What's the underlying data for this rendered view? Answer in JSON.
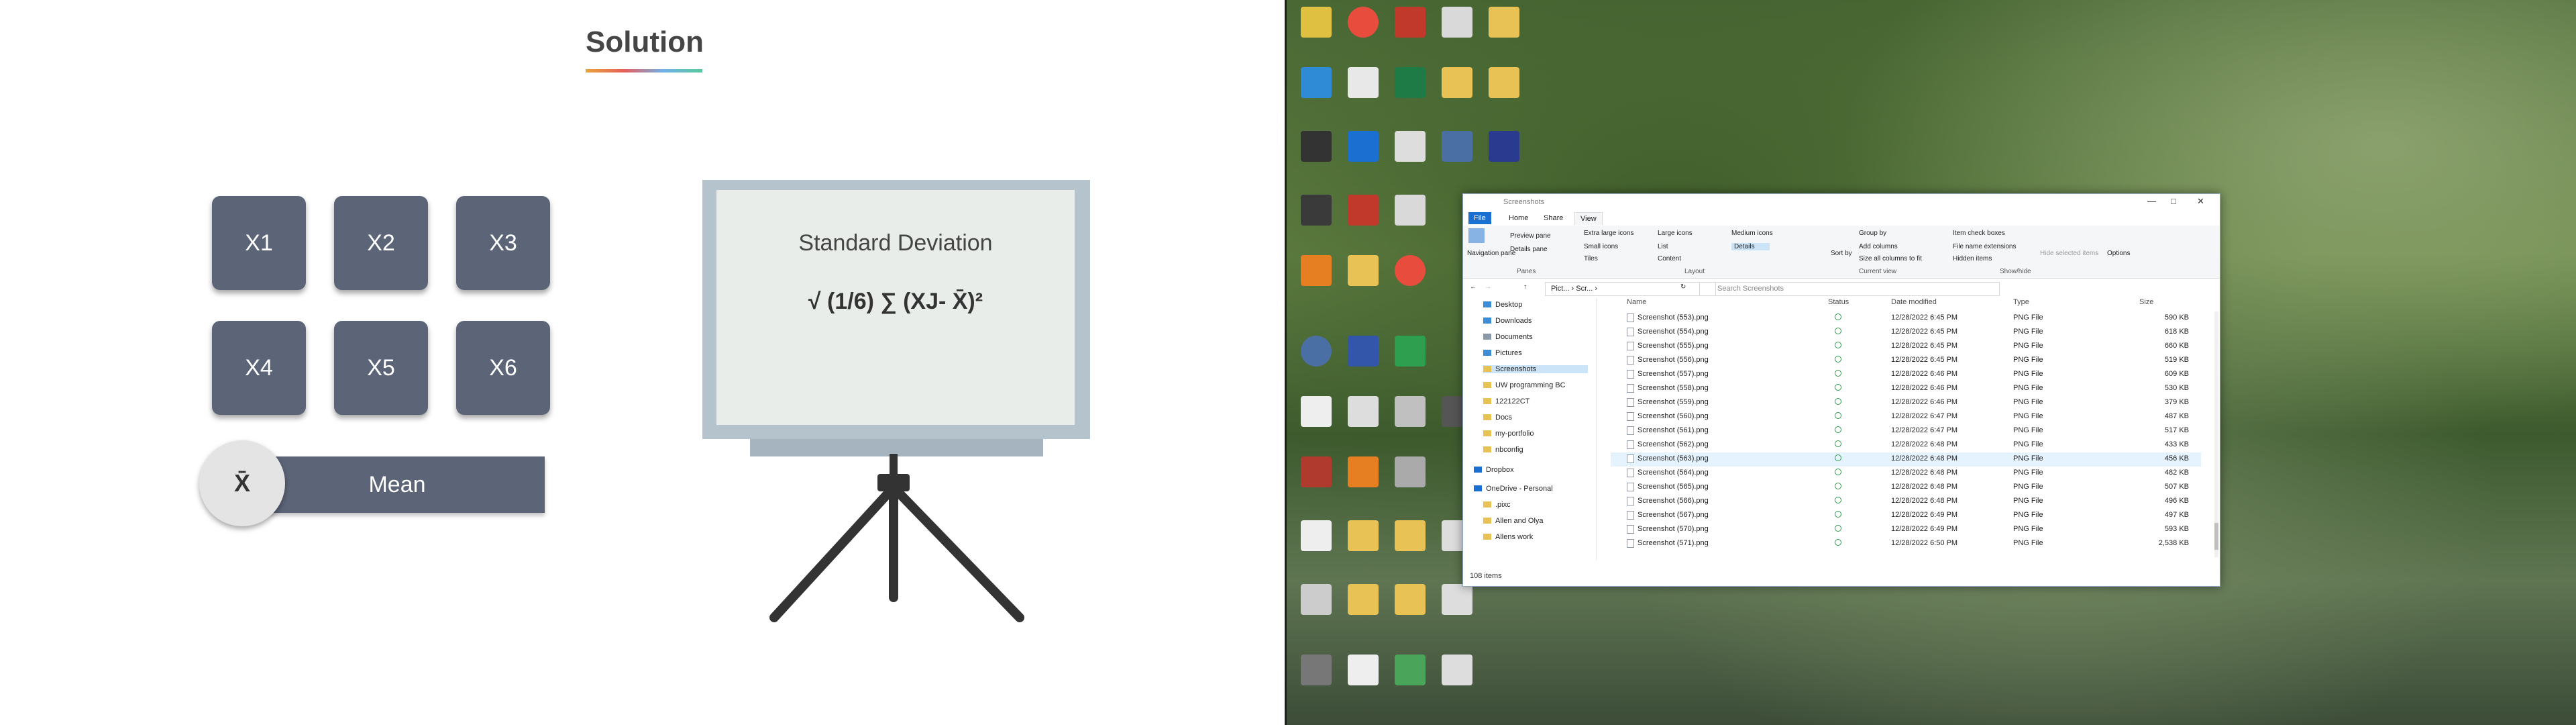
{
  "slide": {
    "title": "Solution",
    "x_buttons": [
      "X1",
      "X2",
      "X3",
      "X4",
      "X5",
      "X6"
    ],
    "mean_symbol": "X̄",
    "mean_label": "Mean",
    "board_title": "Standard Deviation",
    "formula": "√ (1/6) ∑ (XJ- X̄)²"
  },
  "explorer": {
    "window_title": "Screenshots",
    "tabs": [
      "File",
      "Home",
      "Share",
      "View"
    ],
    "ribbon": {
      "panes": [
        "Navigation pane",
        "Preview pane",
        "Details pane"
      ],
      "layout": [
        "Extra large icons",
        "Large icons",
        "Medium icons",
        "Small icons",
        "List",
        "Details",
        "Tiles",
        "Content"
      ],
      "current_view": [
        "Sort by",
        "Group by",
        "Add columns",
        "Size all columns to fit"
      ],
      "show_hide": [
        "Item check boxes",
        "File name extensions",
        "Hidden items",
        "Hide selected items"
      ],
      "options": "Options",
      "groups": [
        "Panes",
        "Layout",
        "Current view",
        "Show/hide"
      ]
    },
    "address": "Pict... › Scr... ›",
    "search_placeholder": "Search Screenshots",
    "nav_items": [
      "Desktop",
      "Downloads",
      "Documents",
      "Pictures",
      "Screenshots",
      "UW programming BC",
      "122122CT",
      "Docs",
      "my-portfolio",
      "nbconfig",
      "Dropbox",
      "OneDrive - Personal",
      ".pixc",
      "Allen and Olya",
      "Allens work"
    ],
    "columns": [
      "Name",
      "Status",
      "Date modified",
      "Type",
      "Size"
    ],
    "files": [
      {
        "name": "Screenshot (553).png",
        "date": "12/28/2022 6:45 PM",
        "type": "PNG File",
        "size": "590 KB"
      },
      {
        "name": "Screenshot (554).png",
        "date": "12/28/2022 6:45 PM",
        "type": "PNG File",
        "size": "618 KB"
      },
      {
        "name": "Screenshot (555).png",
        "date": "12/28/2022 6:45 PM",
        "type": "PNG File",
        "size": "660 KB"
      },
      {
        "name": "Screenshot (556).png",
        "date": "12/28/2022 6:45 PM",
        "type": "PNG File",
        "size": "519 KB"
      },
      {
        "name": "Screenshot (557).png",
        "date": "12/28/2022 6:46 PM",
        "type": "PNG File",
        "size": "609 KB"
      },
      {
        "name": "Screenshot (558).png",
        "date": "12/28/2022 6:46 PM",
        "type": "PNG File",
        "size": "530 KB"
      },
      {
        "name": "Screenshot (559).png",
        "date": "12/28/2022 6:46 PM",
        "type": "PNG File",
        "size": "379 KB"
      },
      {
        "name": "Screenshot (560).png",
        "date": "12/28/2022 6:47 PM",
        "type": "PNG File",
        "size": "487 KB"
      },
      {
        "name": "Screenshot (561).png",
        "date": "12/28/2022 6:47 PM",
        "type": "PNG File",
        "size": "517 KB"
      },
      {
        "name": "Screenshot (562).png",
        "date": "12/28/2022 6:48 PM",
        "type": "PNG File",
        "size": "433 KB"
      },
      {
        "name": "Screenshot (563).png",
        "date": "12/28/2022 6:48 PM",
        "type": "PNG File",
        "size": "456 KB"
      },
      {
        "name": "Screenshot (564).png",
        "date": "12/28/2022 6:48 PM",
        "type": "PNG File",
        "size": "482 KB"
      },
      {
        "name": "Screenshot (565).png",
        "date": "12/28/2022 6:48 PM",
        "type": "PNG File",
        "size": "507 KB"
      },
      {
        "name": "Screenshot (566).png",
        "date": "12/28/2022 6:48 PM",
        "type": "PNG File",
        "size": "496 KB"
      },
      {
        "name": "Screenshot (567).png",
        "date": "12/28/2022 6:49 PM",
        "type": "PNG File",
        "size": "497 KB"
      },
      {
        "name": "Screenshot (570).png",
        "date": "12/28/2022 6:49 PM",
        "type": "PNG File",
        "size": "593 KB"
      },
      {
        "name": "Screenshot (571).png",
        "date": "12/28/2022 6:50 PM",
        "type": "PNG File",
        "size": "2,538 KB"
      }
    ],
    "item_count": "108 items"
  },
  "desktop": {
    "icons": [
      "Recycle Bin",
      "Google Chrome",
      "Adobe Acrobat",
      "Dropbox",
      "Visual Studio Code",
      "Excel",
      "Oracle VM VirtualBox",
      "Python",
      "Google Earth",
      "Camera",
      "Zoom",
      "WhatsApp",
      "Word",
      "Notepad"
    ]
  }
}
